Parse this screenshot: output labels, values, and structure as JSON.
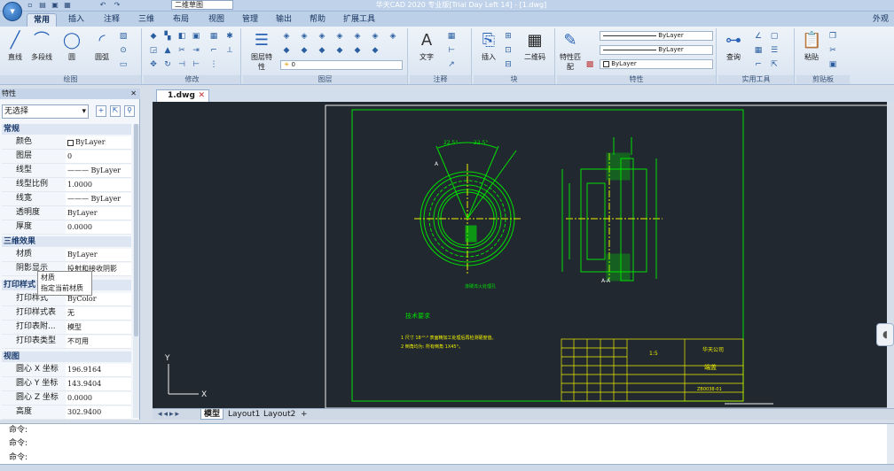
{
  "window": {
    "title": "华天CAD 2020 专业版[Trial Day Left 14] - [1.dwg]",
    "workspace": "二维草图"
  },
  "ribbon_tabs": [
    "常用",
    "插入",
    "注释",
    "三维",
    "布局",
    "视图",
    "管理",
    "输出",
    "帮助",
    "扩展工具"
  ],
  "appearance_label": "外观",
  "ribbon": {
    "draw": {
      "label": "绘图",
      "buttons": [
        "直线",
        "多段线",
        "圆",
        "圆弧"
      ]
    },
    "modify": {
      "label": "修改"
    },
    "layers": {
      "label": "图层",
      "button": "图层特性",
      "layer_value": "0"
    },
    "annotation": {
      "label": "注释",
      "button": "文字"
    },
    "block": {
      "label": "块",
      "insert": "插入",
      "qrcode": "二维码"
    },
    "properties": {
      "label": "特性",
      "match": "特性匹配",
      "line1": "ByLayer",
      "line2": "ByLayer",
      "color": "ByLayer"
    },
    "utilities": {
      "label": "实用工具",
      "query": "查询"
    },
    "clipboard": {
      "label": "剪贴板",
      "paste": "粘贴"
    }
  },
  "doc_tab": {
    "name": "1.dwg"
  },
  "properties_panel": {
    "title": "特性",
    "selection": "无选择",
    "sections": [
      {
        "name": "常规",
        "rows": [
          {
            "key": "颜色",
            "value": "ByLayer"
          },
          {
            "key": "图层",
            "value": "0"
          },
          {
            "key": "线型",
            "value": "——— ByLayer"
          },
          {
            "key": "线型比例",
            "value": "1.0000"
          },
          {
            "key": "线宽",
            "value": "——— ByLayer"
          },
          {
            "key": "透明度",
            "value": "ByLayer"
          },
          {
            "key": "厚度",
            "value": "0.0000"
          }
        ]
      },
      {
        "name": "三维效果",
        "rows": [
          {
            "key": "材质",
            "value": "ByLayer"
          },
          {
            "key": "阴影显示",
            "value": "投射和接收阴影"
          }
        ]
      },
      {
        "name": "打印样式",
        "rows": [
          {
            "key": "打印样式",
            "value": "ByColor"
          },
          {
            "key": "打印样式表",
            "value": "无"
          },
          {
            "key": "打印表附...",
            "value": "模型"
          },
          {
            "key": "打印表类型",
            "value": "不可用"
          }
        ]
      },
      {
        "name": "视图",
        "rows": [
          {
            "key": "圆心 X 坐标",
            "value": "196.9164"
          },
          {
            "key": "圆心 Y 坐标",
            "value": "143.9404"
          },
          {
            "key": "圆心 Z 坐标",
            "value": "0.0000"
          },
          {
            "key": "高度",
            "value": "302.9400"
          }
        ]
      }
    ],
    "tooltip": {
      "line1": "材质",
      "line2": "指定当前材质"
    }
  },
  "drawing": {
    "tech_title": "技术要求",
    "note1": "1  尺寸 18⁺⁰·⁰ 表面精加工处理后再检测硬度值。",
    "note2": "2  倒角均为: 所有倒角 1X45°。",
    "section_label": "A-A",
    "label_a": "A",
    "title_name": "端盖",
    "title_code": "ZB0038-01",
    "title_company": "华天公司",
    "title_scale": "1:5",
    "callout": "渗碳淬火处理孔"
  },
  "layout_tabs": [
    "模型",
    "Layout1",
    "Layout2",
    "+"
  ],
  "command_lines": [
    "命令:",
    "命令:",
    "命令:"
  ],
  "colors": {
    "canvas": "#212830",
    "accent": "#2a63b6",
    "drawing_green": "#00e000",
    "drawing_yellow": "#f0f000"
  }
}
